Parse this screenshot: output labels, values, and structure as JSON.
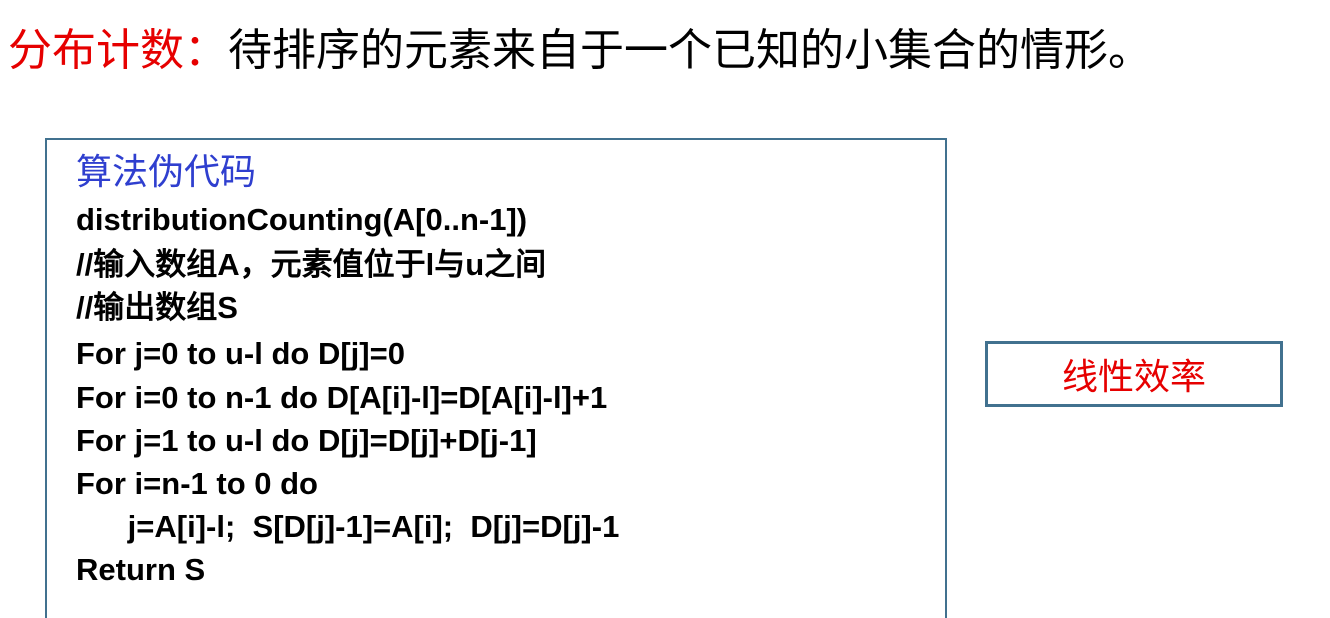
{
  "title": {
    "term": "分布计数：",
    "description": "待排序的元素来自于一个已知的小集合的情形。"
  },
  "code_box": {
    "heading": "算法伪代码",
    "lines": [
      "distributionCounting(A[0..n-1])",
      "//输入数组A，元素值位于l与u之间",
      "//输出数组S",
      "For j=0 to u-l do D[j]=0",
      "For i=0 to n-1 do D[A[i]-l]=D[A[i]-l]+1",
      "For j=1 to u-l do D[j]=D[j]+D[j-1]",
      "For i=n-1 to 0 do",
      "      j=A[i]-l;  S[D[j]-1]=A[i];  D[j]=D[j]-1",
      "Return S"
    ]
  },
  "result_box": {
    "label": "线性效率"
  },
  "colors": {
    "term": "#e60000",
    "heading": "#2f3fcf",
    "border": "#41718f",
    "label": "#e60000"
  }
}
